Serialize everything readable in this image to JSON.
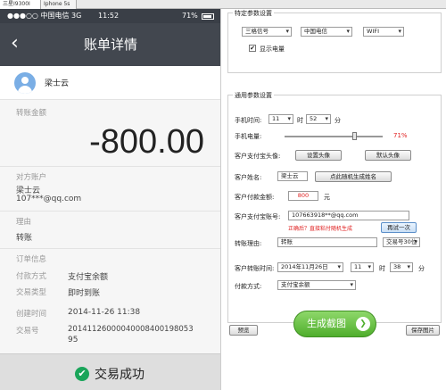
{
  "tabs": [
    "三星I9300I",
    "Iphone 5s"
  ],
  "phone": {
    "status": {
      "carrier": "●●●○○ 中国电信 3G",
      "time": "11:52",
      "battery": "71%"
    },
    "title": "账单详情",
    "back_icon": "‹",
    "user_name": "梁士云",
    "amount_label": "转账金额",
    "amount": "-800.00",
    "counterparty_label": "对方账户",
    "counterparty_name": "梁士云",
    "counterparty_email": "107***@qq.com",
    "reason_label": "理由",
    "reason": "转账",
    "order_label": "订单信息",
    "rows": [
      {
        "label": "付款方式",
        "value": "支付宝余额"
      },
      {
        "label": "交易类型",
        "value": "即时到账"
      },
      {
        "label": "创建时间",
        "value": "2014-11-26 11:38"
      },
      {
        "label": "交易号",
        "value": "20141126000040008400198053"
      },
      {
        "label": "",
        "value": "95"
      }
    ],
    "success_text": "交易成功",
    "success_icon": "✔"
  },
  "panel": {
    "specific_title": "特定参数设置",
    "signal": "三格信号",
    "carrier": "中国电信",
    "network": "WIFI",
    "show_battery": "显示电量",
    "show_battery_checked": "✔",
    "general_title": "通用参数设置",
    "phone_time_label": "手机时间:",
    "hour": "11",
    "hour_unit": "时",
    "minute": "52",
    "minute_unit": "分",
    "battery_label": "手机电量:",
    "battery_value": "71%",
    "battery_level": 0.71,
    "avatar_label": "客户支付宝头像:",
    "set_avatar": "设置头像",
    "default_avatar": "默认头像",
    "name_label": "客户姓名:",
    "name_value": "梁士云",
    "random_name": "点此随机生成姓名",
    "amount_label": "客户付款金额:",
    "amount_value": "800",
    "amount_unit": "元",
    "account_label": "客户支付宝账号:",
    "account_value": "107663918**@qq.com",
    "hint": "正确后？直接粘付随机生成",
    "retry": "再试一次",
    "reason_label": "转账理由:",
    "reason_value": "转账",
    "trade_no": "交易号30位",
    "time_label": "客户转账时间:",
    "date_value": "2014年11月26日",
    "t_hour": "11",
    "t_hour_unit": "时",
    "t_minute": "38",
    "t_minute_unit": "分",
    "pay_label": "付款方式:",
    "pay_value": "支付宝余额",
    "preview": "预览",
    "generate": "生成截图",
    "generate_icon": "❯",
    "save": "保存图片"
  }
}
